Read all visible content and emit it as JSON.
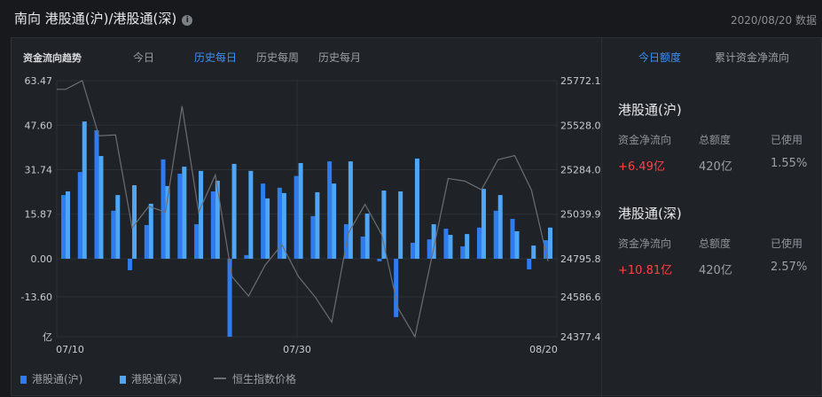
{
  "header": {
    "title": "南向 港股通(沪)/港股通(深)",
    "info_icon": "i",
    "date": "2020/08/20 数据"
  },
  "chart_tabs": {
    "label": "资金流向趋势",
    "items": [
      "今日",
      "历史每日",
      "历史每周",
      "历史每月"
    ],
    "active": 1
  },
  "right_tabs": {
    "items": [
      "今日额度",
      "累计资金净流向"
    ],
    "active": 0
  },
  "colors": {
    "sh": "#2f7bf0",
    "sz": "#4ea6f7",
    "line": "#6b6f73",
    "up": "#ff4141",
    "accent": "#3d8ef5"
  },
  "chart_data": {
    "type": "bar",
    "left_ticks": [
      "63.47",
      "47.60",
      "31.74",
      "15.87",
      "0.00",
      "-13.60",
      "亿"
    ],
    "right_ticks": [
      "25772.1",
      "25528.0",
      "25284.0",
      "25039.9",
      "24795.8",
      "24586.6",
      "24377.4"
    ],
    "x_ticks": [
      "07/10",
      "07/30",
      "08/20"
    ],
    "ylim": [
      -27.8,
      63.47
    ],
    "y2lim": [
      24377.4,
      25772.1
    ],
    "ylabel": "亿",
    "series": [
      {
        "name": "港股通(沪)",
        "type": "bar",
        "values": [
          22.7,
          30.9,
          45.8,
          17.1,
          -4.1,
          12.0,
          35.4,
          30.3,
          12.3,
          24.0,
          -27.8,
          1.3,
          26.8,
          25.3,
          29.5,
          15.2,
          34.7,
          12.3,
          7.9,
          -0.9,
          -20.8,
          5.7,
          6.9,
          10.7,
          4.4,
          11.1,
          17.1,
          14.2,
          -3.8,
          6.6
        ]
      },
      {
        "name": "港股通(深)",
        "type": "bar",
        "values": [
          24.0,
          48.9,
          36.6,
          22.7,
          26.2,
          19.6,
          25.9,
          32.8,
          31.3,
          27.8,
          33.8,
          31.3,
          21.5,
          23.4,
          34.1,
          23.7,
          26.8,
          34.7,
          16.1,
          24.3,
          24.0,
          35.7,
          12.3,
          8.5,
          8.8,
          24.9,
          22.7,
          9.8,
          4.7,
          11.1
        ]
      },
      {
        "name": "恒生指数价格",
        "type": "line",
        "values": [
          25724.7,
          25772.1,
          25471.7,
          25476.4,
          24970.5,
          25087.5,
          25055.9,
          25633,
          25055.9,
          25258.3,
          24704.9,
          24599,
          24768,
          24878.8,
          24704.9,
          24594.3,
          24456.7,
          24942,
          25098.6,
          24934,
          24531,
          24377.7,
          24804.5,
          25239.3,
          25225,
          25177.6,
          25342,
          25364,
          25177.6,
          24788.7
        ]
      }
    ]
  },
  "sections": [
    {
      "title": "港股通(沪)",
      "headers": [
        "资金净流向",
        "总额度",
        "已使用"
      ],
      "net": "+6.49亿",
      "quota": "420亿",
      "used": "1.55%"
    },
    {
      "title": "港股通(深)",
      "headers": [
        "资金净流向",
        "总额度",
        "已使用"
      ],
      "net": "+10.81亿",
      "quota": "420亿",
      "used": "2.57%"
    }
  ]
}
